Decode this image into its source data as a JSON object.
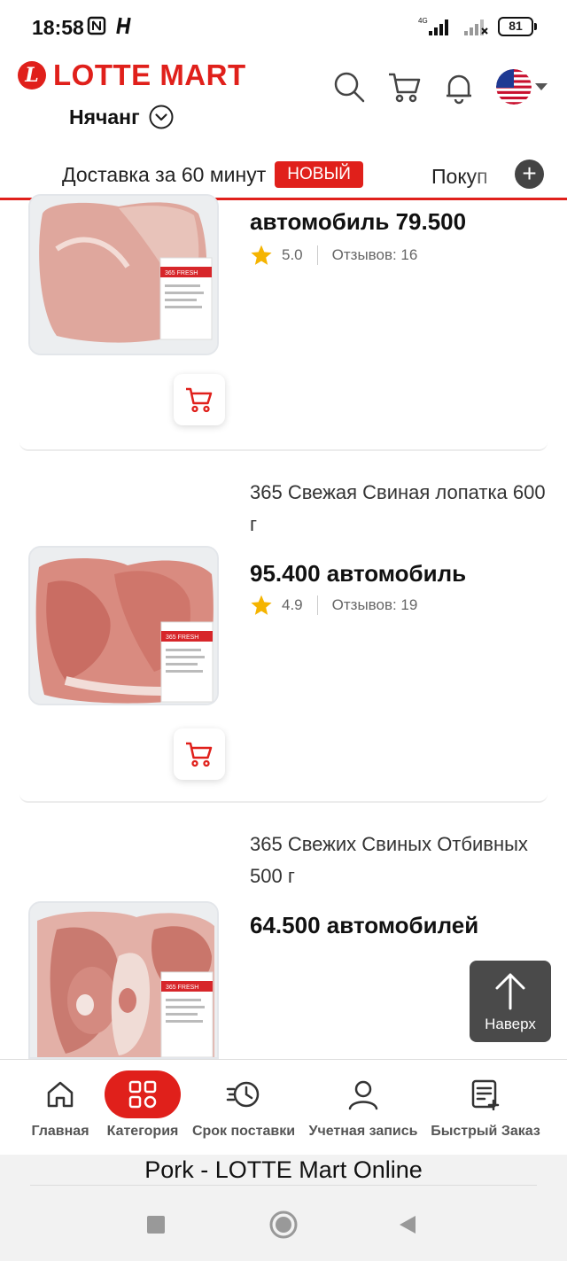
{
  "status_bar": {
    "time": "18:58",
    "battery": "81",
    "network": "4G"
  },
  "header": {
    "logo_mark": "L",
    "logo_text": "LOTTE MART",
    "location": "Нячанг"
  },
  "tabs": {
    "delivery_label": "Доставка за 60 минут",
    "new_badge": "НОВЫЙ",
    "second_tab_partial": "Покуп",
    "more": "+"
  },
  "products": [
    {
      "price": "автомобиль 79.500",
      "rating": "5.0",
      "reviews": "Отзывов: 16"
    },
    {
      "title": "365 Свежая Свиная лопатка 600 г",
      "price": "95.400 автомобиль",
      "rating": "4.9",
      "reviews": "Отзывов: 19"
    },
    {
      "title": "365 Свежих Свиных Отбивных 500 г",
      "price": "64.500 автомобилей"
    }
  ],
  "to_top": {
    "label": "Наверх"
  },
  "bottom_nav": [
    {
      "label": "Главная"
    },
    {
      "label": "Категория"
    },
    {
      "label": "Срок поставки"
    },
    {
      "label": "Учетная запись"
    },
    {
      "label": "Быстрый Заказ"
    }
  ],
  "browser": {
    "page_title": "Pork - LOTTE Mart Online"
  },
  "colors": {
    "brand_red": "#e0201b",
    "star": "#f5b400"
  }
}
